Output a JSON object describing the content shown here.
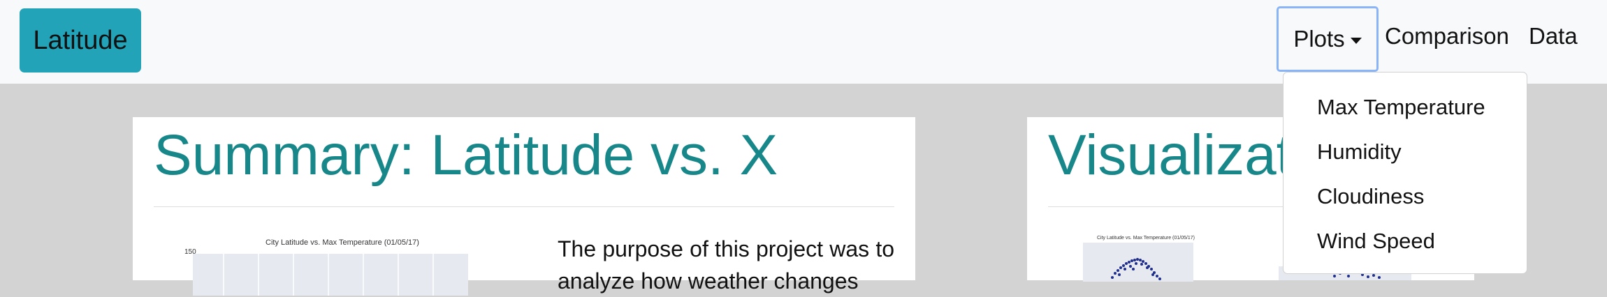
{
  "navbar": {
    "brand": "Latitude",
    "plots_label": "Plots",
    "comparison_label": "Comparison",
    "data_label": "Data"
  },
  "dropdown": {
    "items": [
      "Max Temperature",
      "Humidity",
      "Cloudiness",
      "Wind Speed"
    ]
  },
  "summary": {
    "title": "Summary: Latitude vs. X",
    "paragraph": "The purpose of this project was to analyze how weather changes",
    "thumb_title": "City Latitude vs. Max Temperature (01/05/17)",
    "thumb_y_tick": "150"
  },
  "visualization": {
    "title": "Visualizations",
    "thumb_title": "City Latitude vs. Max Temperature (01/05/17)"
  },
  "colors": {
    "accent": "#17878a",
    "brand_bg": "#22a3b8",
    "plot_bg": "#e6e9f0",
    "scatter": "#1f2f8a"
  }
}
